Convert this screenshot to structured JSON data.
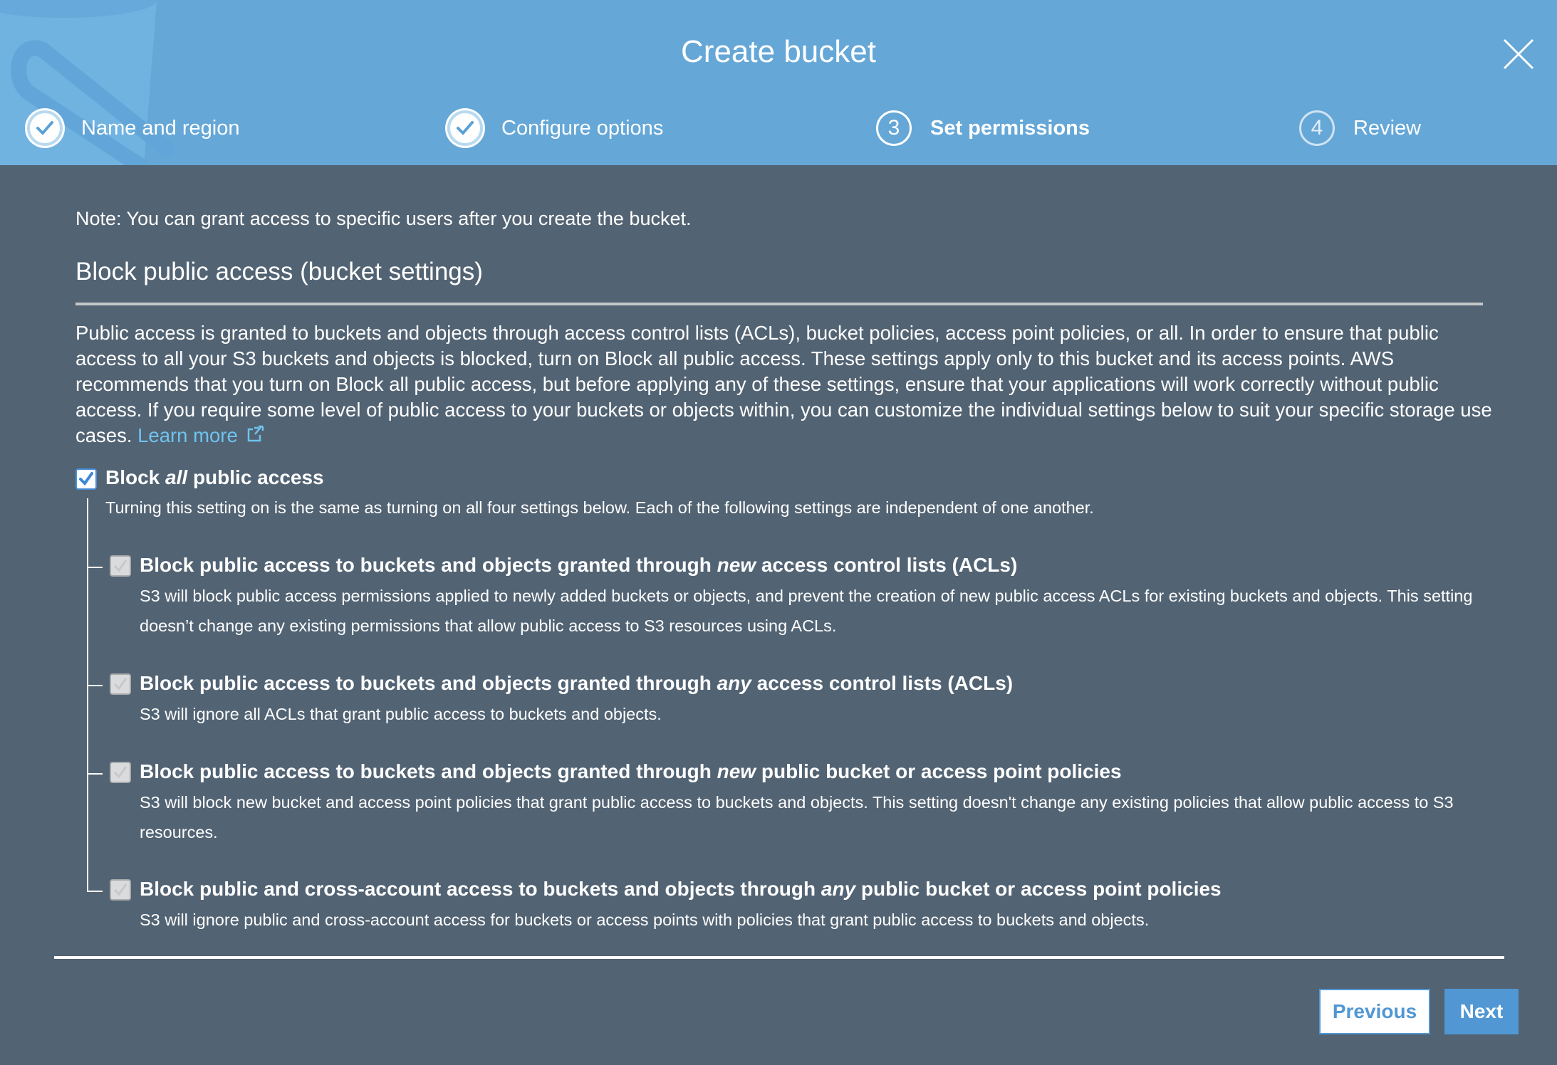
{
  "dialog": {
    "title": "Create bucket",
    "close_icon": "close-icon"
  },
  "steps": [
    {
      "label": "Name and region",
      "state": "complete",
      "icon": "check-circle-icon"
    },
    {
      "label": "Configure options",
      "state": "complete",
      "icon": "check-circle-icon"
    },
    {
      "label": "Set permissions",
      "state": "active",
      "number": "3"
    },
    {
      "label": "Review",
      "state": "upcoming",
      "number": "4"
    }
  ],
  "content": {
    "note": "Note: You can grant access to specific users after you create the bucket.",
    "heading": "Block public access (bucket settings)",
    "paragraph": "Public access is granted to buckets and objects through access control lists (ACLs), bucket policies, access point policies, or all. In order to ensure that public access to all your S3 buckets and objects is blocked, turn on Block all public access. These settings apply only to this bucket and its access points. AWS recommends that you turn on Block all public access, but before applying any of these settings, ensure that your applications will work correctly without public access. If you require some level of public access to your buckets or objects within, you can customize the individual settings below to suit your specific storage use cases.",
    "learn_more": "Learn more",
    "learn_more_icon": "external-link-icon",
    "link_color": "#6fc3ef"
  },
  "block_all": {
    "label_pre": "Block ",
    "label_em": "all",
    "label_post": " public access",
    "checked": true,
    "description": "Turning this setting on is the same as turning on all four settings below. Each of the following settings are independent of one another."
  },
  "settings": [
    {
      "title_pre": "Block public access to buckets and objects granted through ",
      "title_em": "new",
      "title_post": " access control lists (ACLs)",
      "description": "S3 will block public access permissions applied to newly added buckets or objects, and prevent the creation of new public access ACLs for existing buckets and objects. This setting doesn’t change any existing permissions that allow public access to S3 resources using ACLs.",
      "checked": true,
      "disabled": true
    },
    {
      "title_pre": "Block public access to buckets and objects granted through ",
      "title_em": "any",
      "title_post": " access control lists (ACLs)",
      "description": "S3 will ignore all ACLs that grant public access to buckets and objects.",
      "checked": true,
      "disabled": true
    },
    {
      "title_pre": "Block public access to buckets and objects granted through ",
      "title_em": "new",
      "title_post": " public bucket or access point policies",
      "description": "S3 will block new bucket and access point policies that grant public access to buckets and objects. This setting doesn't change any existing policies that allow public access to S3 resources.",
      "checked": true,
      "disabled": true
    },
    {
      "title_pre": "Block public and cross-account access to buckets and objects through ",
      "title_em": "any",
      "title_post": " public bucket or access point policies",
      "description": "S3 will ignore public and cross-account access for buckets or access points with policies that grant public access to buckets and objects.",
      "checked": true,
      "disabled": true
    }
  ],
  "footer": {
    "previous_label": "Previous",
    "next_label": "Next"
  },
  "colors": {
    "header_bg": "#65a7d7",
    "body_bg": "#526373",
    "primary": "#5097d4",
    "checkbox_border": "#4a90d8"
  }
}
